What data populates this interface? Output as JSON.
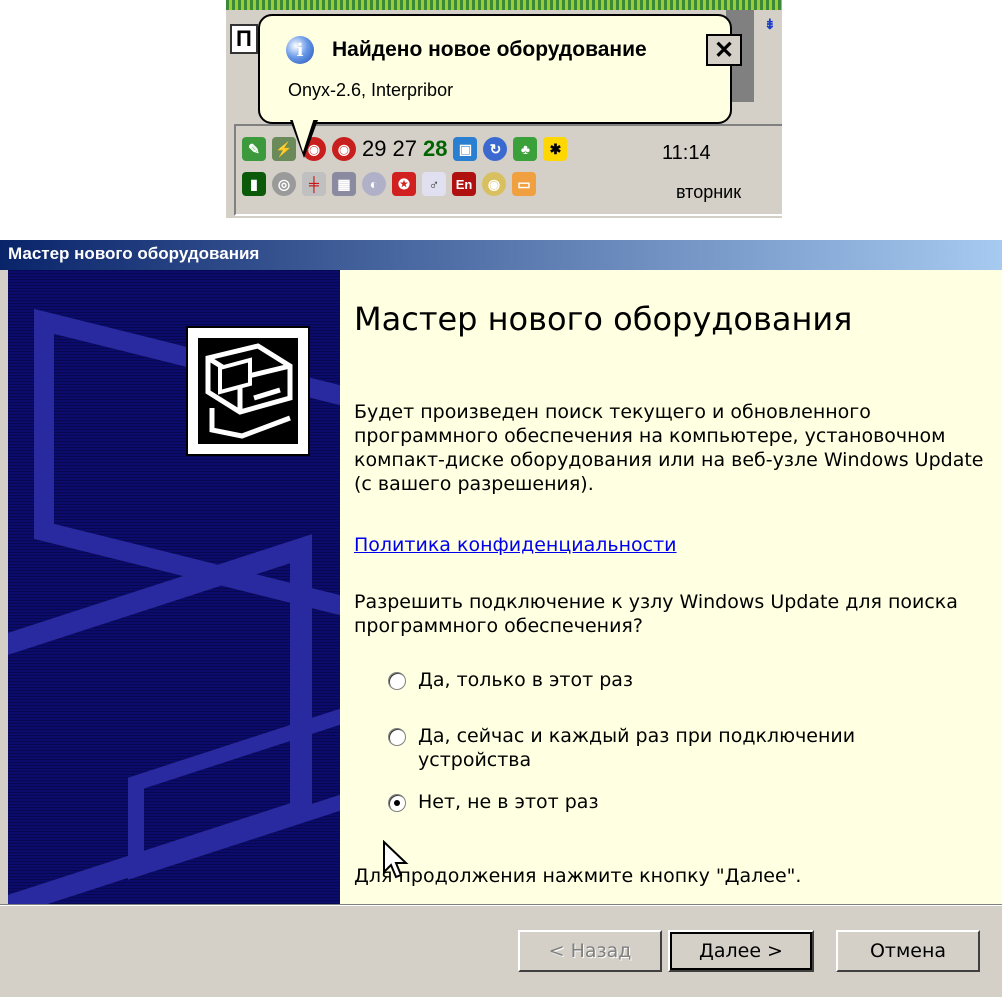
{
  "tray": {
    "partial_button": "П",
    "scroll_arrow": "⇟",
    "numbers": [
      "29",
      "27",
      "28"
    ],
    "time": "11:14",
    "day": "вторник",
    "lang": "En"
  },
  "balloon": {
    "title": "Найдено новое оборудование",
    "body": "Onyx-2.6, Interpribor",
    "close": "✕",
    "info": "i"
  },
  "wizard": {
    "window_title": "Мастер нового оборудования",
    "heading": "Мастер нового оборудования",
    "intro": "Будет произведен поиск текущего и обновленного программного обеспечения на компьютере, установочном компакт-диске оборудования или на веб-узле Windows Update (с вашего разрешения).",
    "privacy_link": "Политика конфиденциальности",
    "question": "Разрешить подключение к узлу Windows Update для поиска программного обеспечения?",
    "options": [
      {
        "label": "Да, только в этот раз",
        "checked": false
      },
      {
        "label": "Да, сейчас и каждый раз при подключении устройства",
        "checked": false
      },
      {
        "label": "Нет, не в этот раз",
        "checked": true
      }
    ],
    "continue_hint": "Для продолжения нажмите кнопку \"Далее\".",
    "buttons": {
      "back": "< Назад",
      "next": "Далее >",
      "cancel": "Отмена"
    }
  }
}
